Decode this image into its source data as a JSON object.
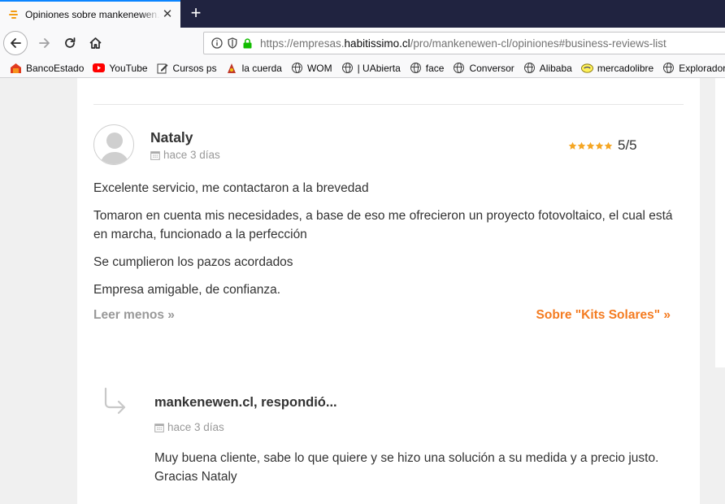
{
  "browser": {
    "tab": {
      "title": "Opiniones sobre mankenewen.cl"
    },
    "address": {
      "prefix": "https://empresas.",
      "domain": "habitissimo.cl",
      "path": "/pro/mankenewen-cl/opiniones#business-reviews-list"
    },
    "bookmarks": [
      {
        "label": "BancoEstado",
        "icon": "bancoestado-icon"
      },
      {
        "label": "YouTube",
        "icon": "youtube-icon"
      },
      {
        "label": "Cursos ps",
        "icon": "edit-icon"
      },
      {
        "label": "la cuerda",
        "icon": "lacuerda-icon"
      },
      {
        "label": "WOM",
        "icon": "globe-icon"
      },
      {
        "label": "| UAbierta",
        "icon": "globe-icon"
      },
      {
        "label": "face",
        "icon": "globe-icon"
      },
      {
        "label": "Conversor",
        "icon": "globe-icon"
      },
      {
        "label": "Alibaba",
        "icon": "globe-icon"
      },
      {
        "label": "mercadolibre",
        "icon": "mercadolibre-icon"
      },
      {
        "label": "Explorador",
        "icon": "globe-icon"
      }
    ]
  },
  "review": {
    "name": "Nataly",
    "date": "hace 3 días",
    "rating": 5,
    "rating_text": "5/5",
    "paragraphs": [
      "Excelente servicio, me contactaron a la brevedad",
      "Tomaron en cuenta mis necesidades, a base de eso me ofrecieron un proyecto fotovoltaico, el cual está en marcha, funcionado a la perfección",
      "Se cumplieron los pazos acordados",
      "Empresa amigable, de confianza."
    ],
    "read_less": "Leer menos »",
    "about_link": "Sobre \"Kits Solares\" »"
  },
  "reply": {
    "title": "mankenewen.cl, respondió...",
    "date": "hace 3 días",
    "text": "Muy buena cliente, sabe lo que quiere y se hizo una solución a su medida y a precio justo. Gracias Nataly"
  },
  "colors": {
    "accent": "#f47b20",
    "star": "#f5a623",
    "tab_strip": "#202340"
  }
}
